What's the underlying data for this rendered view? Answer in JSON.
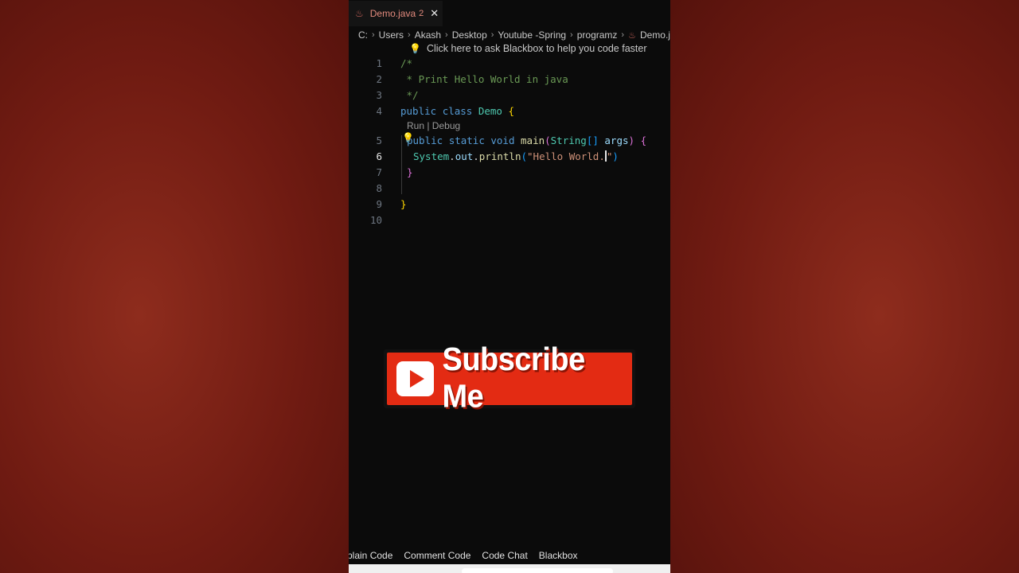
{
  "tab": {
    "label": "Demo.java",
    "badge": "2",
    "icon": "java-icon"
  },
  "breadcrumb": [
    "C:",
    "Users",
    "Akash",
    "Desktop",
    "Youtube -Spring",
    "programz",
    "Demo.ja"
  ],
  "hint": "Click here to ask Blackbox to help you code faster",
  "codelens": "Run | Debug",
  "line_numbers": [
    "1",
    "2",
    "3",
    "4",
    "5",
    "6",
    "7",
    "8",
    "9",
    "10"
  ],
  "code": {
    "line1": "/*",
    "line2": " * Print Hello World in java",
    "line3": " */",
    "line4_kw1": "public",
    "line4_kw2": "class",
    "line4_name": "Demo",
    "line4_brace": "{",
    "line5_kw1": "public",
    "line5_kw2": "static",
    "line5_kw3": "void",
    "line5_fn": "main",
    "line5_type": "String",
    "line5_arr": "[]",
    "line5_arg": "args",
    "line5_brace": "{",
    "line6_obj": "System",
    "line6_field": "out",
    "line6_fn": "println",
    "line6_str": "\"Hello World.",
    "line6_strend": "\"",
    "line7_brace": "}",
    "line9_brace": "}"
  },
  "bottom_bar": [
    "plain Code",
    "Comment Code",
    "Code Chat",
    "Blackbox"
  ],
  "overlay": {
    "subscribe_label": "Subscribe Me"
  },
  "colors": {
    "accent_red": "#e32b13",
    "background_red": "#701b12"
  }
}
